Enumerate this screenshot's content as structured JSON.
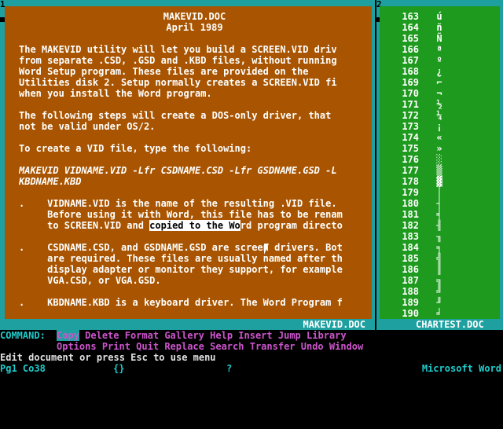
{
  "window1": {
    "number": "1",
    "title": "MAKEVID.DOC",
    "lines": [
      {
        "text": "MAKEVID.DOC",
        "style": "center"
      },
      {
        "text": "April 1989",
        "style": "center"
      },
      {
        "text": "",
        "style": ""
      },
      {
        "text": "The MAKEVID utility will let you build a SCREEN.VID driv",
        "style": ""
      },
      {
        "text": "from separate .CSD, .GSD and .KBD files, without running",
        "style": ""
      },
      {
        "text": "Word Setup program. These files are provided on the",
        "style": ""
      },
      {
        "text": "Utilities disk 2. Setup normally creates a SCREEN.VID fi",
        "style": ""
      },
      {
        "text": "when you install the Word program.",
        "style": ""
      },
      {
        "text": "",
        "style": ""
      },
      {
        "text": "The following steps will create a DOS-only driver, that",
        "style": ""
      },
      {
        "text": "not be valid under OS/2.",
        "style": ""
      },
      {
        "text": "",
        "style": ""
      },
      {
        "text": "To create a VID file, type the following:",
        "style": ""
      },
      {
        "text": "",
        "style": ""
      },
      {
        "text": "MAKEVID VIDNAME.VID -Lfr CSDNAME.CSD -Lfr GSDNAME.GSD -L",
        "style": "it"
      },
      {
        "text": "KBDNAME.KBD",
        "style": "it"
      },
      {
        "text": "",
        "style": ""
      },
      {
        "text": ".    VIDNAME.VID is the name of the resulting .VID file.",
        "style": ""
      },
      {
        "text": "     Before using it with Word, this file has to be renam",
        "style": ""
      },
      {
        "text": "     to SCREEN.VID and ",
        "style": "",
        "sel": "copied to the Wo",
        "after": "rd program directo"
      },
      {
        "text": "",
        "style": ""
      },
      {
        "text": ".    CSDNAME.CSD, and GSDNAME.GSD are screen drivers. Bot",
        "style": ""
      },
      {
        "text": "     are required. These files are usually named after th",
        "style": ""
      },
      {
        "text": "     display adapter or monitor they support, for example",
        "style": ""
      },
      {
        "text": "     VGA.CSD, or VGA.GSD.",
        "style": ""
      },
      {
        "text": "",
        "style": ""
      },
      {
        "text": ".    KBDNAME.KBD is a keyboard driver. The Word Program f",
        "style": ""
      }
    ]
  },
  "window2": {
    "number": "2",
    "title": "CHARTEST.DOC",
    "rows": [
      {
        "num": "163",
        "ch": "ú"
      },
      {
        "num": "164",
        "ch": "ñ"
      },
      {
        "num": "165",
        "ch": "Ñ"
      },
      {
        "num": "166",
        "ch": "ª"
      },
      {
        "num": "167",
        "ch": "º"
      },
      {
        "num": "168",
        "ch": "¿"
      },
      {
        "num": "169",
        "ch": "⌐"
      },
      {
        "num": "170",
        "ch": "¬"
      },
      {
        "num": "171",
        "ch": "½"
      },
      {
        "num": "172",
        "ch": "¼"
      },
      {
        "num": "173",
        "ch": "¡"
      },
      {
        "num": "174",
        "ch": "«"
      },
      {
        "num": "175",
        "ch": "»"
      },
      {
        "num": "176",
        "ch": "░"
      },
      {
        "num": "177",
        "ch": "▒"
      },
      {
        "num": "178",
        "ch": "▓"
      },
      {
        "num": "179",
        "ch": "│"
      },
      {
        "num": "180",
        "ch": "┤"
      },
      {
        "num": "181",
        "ch": "╡"
      },
      {
        "num": "182",
        "ch": "╢"
      },
      {
        "num": "183",
        "ch": "╖"
      },
      {
        "num": "184",
        "ch": "╕"
      },
      {
        "num": "185",
        "ch": "╣"
      },
      {
        "num": "186",
        "ch": "║"
      },
      {
        "num": "187",
        "ch": "╗"
      },
      {
        "num": "188",
        "ch": "╝"
      },
      {
        "num": "189",
        "ch": "╜"
      },
      {
        "num": "190",
        "ch": "╛"
      }
    ]
  },
  "menu": {
    "label": "COMMAND:",
    "row1": [
      "Copy",
      "Delete",
      "Format",
      "Gallery",
      "Help",
      "Insert",
      "Jump",
      "Library"
    ],
    "row2": [
      "Options",
      "Print",
      "Quit",
      "Replace",
      "Search",
      "Transfer",
      "Undo",
      "Window"
    ]
  },
  "status": {
    "message": "Edit document or press Esc to use menu",
    "position": "Pg1 Co38",
    "braces": "{}",
    "question": "?",
    "app_name": "Microsoft Word"
  }
}
